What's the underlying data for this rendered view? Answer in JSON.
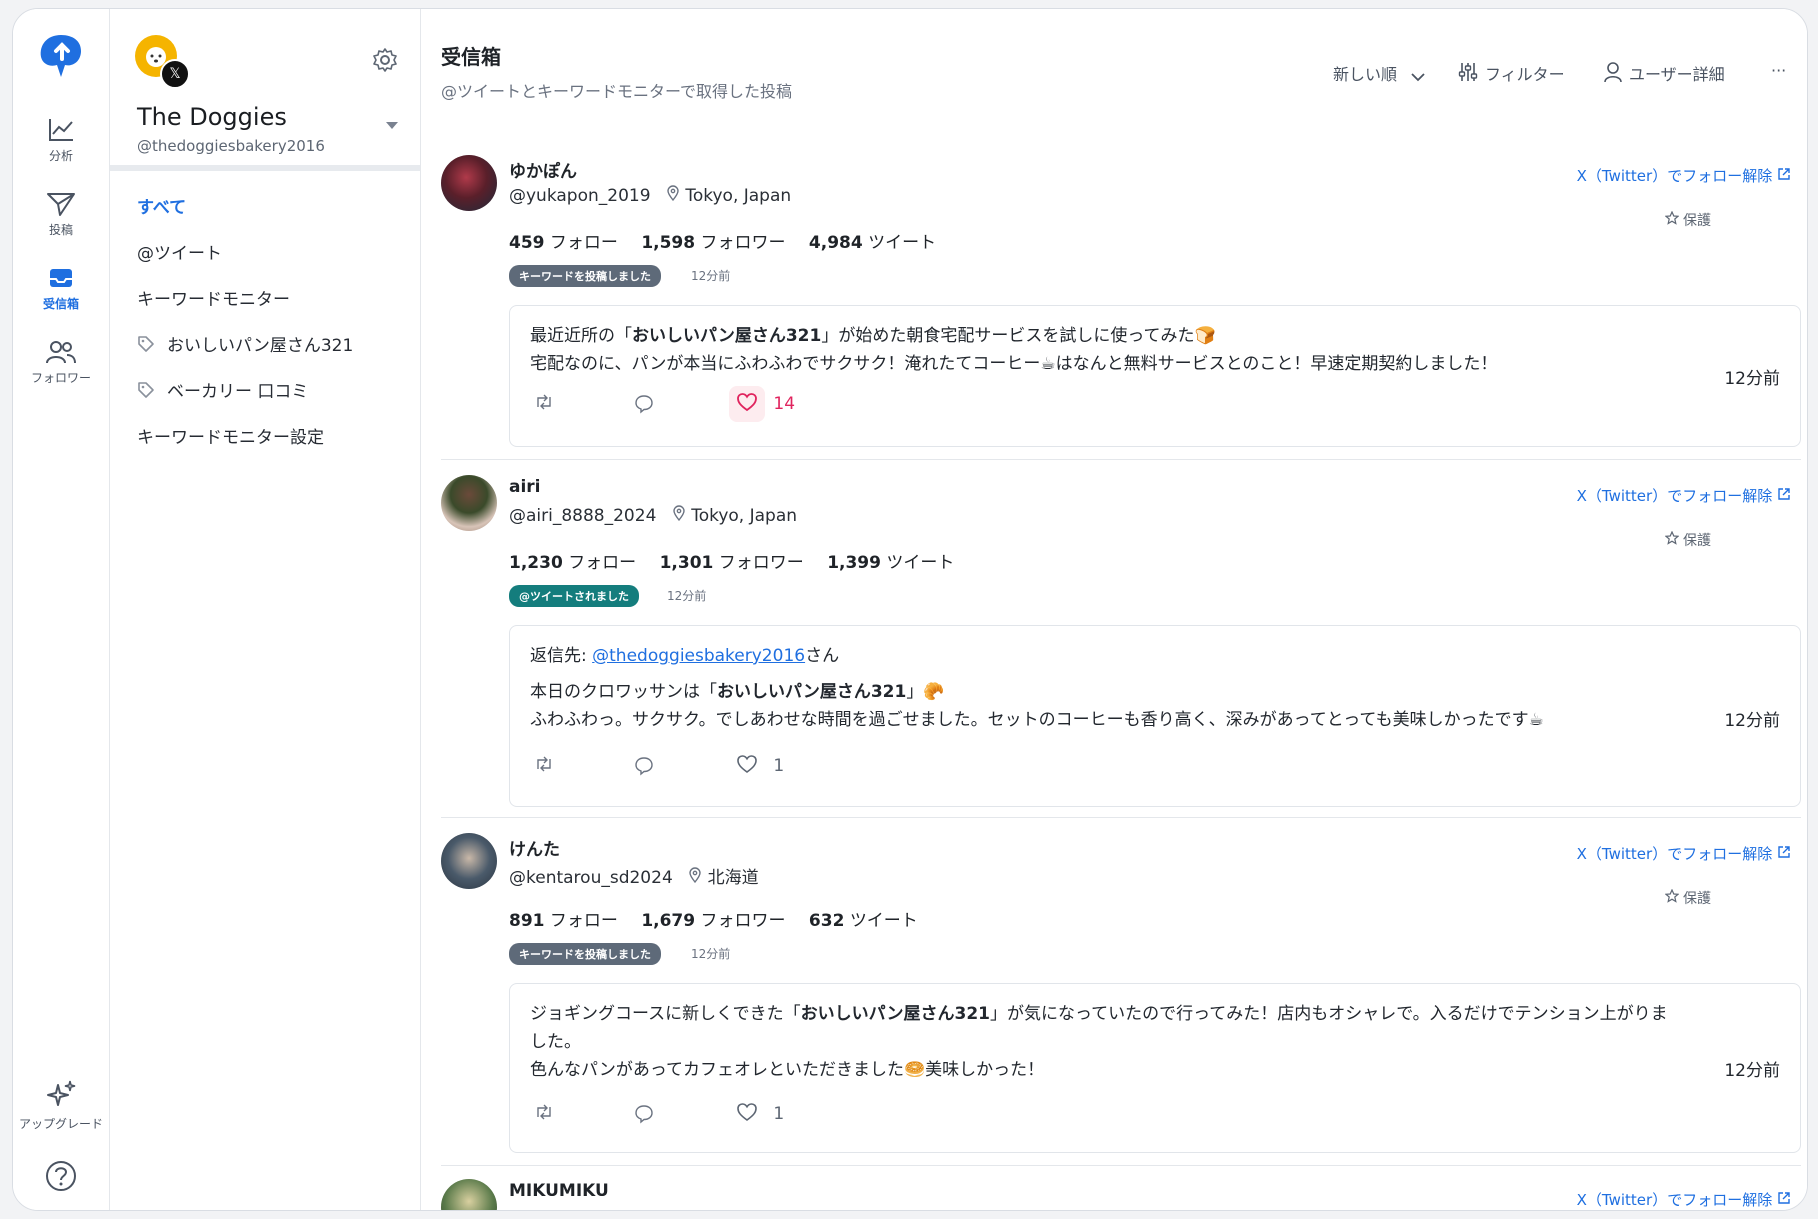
{
  "rail": {
    "items": [
      {
        "label": "分析"
      },
      {
        "label": "投稿"
      },
      {
        "label": "受信箱"
      },
      {
        "label": "フォロワー"
      }
    ],
    "upgrade": "アップグレード"
  },
  "account": {
    "name": "The Doggies",
    "handle": "@thedoggiesbakery2016"
  },
  "nav": {
    "all": "すべて",
    "tweets": "@ツイート",
    "keyword_monitor": "キーワードモニター",
    "tag1": "おいしいパン屋さん321",
    "tag2": "ベーカリー 口コミ",
    "settings": "キーワードモニター設定"
  },
  "header": {
    "title": "受信箱",
    "subtitle": "@ツイートとキーワードモニターで取得した投稿",
    "sort": "新しい順",
    "filter": "フィルター",
    "user_detail": "ユーザー詳細",
    "more": "···"
  },
  "posts": [
    {
      "name": "ゆかぽん",
      "handle": "@yukapon_2019",
      "location": "Tokyo, Japan",
      "following": "459",
      "following_label": "フォロー",
      "followers": "1,598",
      "followers_label": "フォロワー",
      "tweets": "4,984",
      "tweets_label": "ツイート",
      "badge": "キーワードを投稿しました",
      "badge_time": "12分前",
      "unfollow": "X（Twitter）でフォロー解除",
      "protect": "保護",
      "text1_pre": "最近近所の「",
      "text1_bold": "おいしいパン屋さん321",
      "text1_post": "」が始めた朝食宅配サービスを試しに使ってみた🍞",
      "text2": "宅配なのに、パンが本当にふわふわでサクサク！淹れたてコーヒー☕はなんと無料サービスとのこと！早速定期契約しました！",
      "time": "12分前",
      "likes": "14"
    },
    {
      "name": "airi",
      "handle": "@airi_8888_2024",
      "location": "Tokyo, Japan",
      "following": "1,230",
      "following_label": "フォロー",
      "followers": "1,301",
      "followers_label": "フォロワー",
      "tweets": "1,399",
      "tweets_label": "ツイート",
      "badge": "@ツイートされました",
      "badge_time": "12分前",
      "unfollow": "X（Twitter）でフォロー解除",
      "protect": "保護",
      "reply_prefix": "返信先: ",
      "reply_to": "@thedoggiesbakery2016",
      "reply_suffix": "さん",
      "text1_pre": "本日のクロワッサンは「",
      "text1_bold": "おいしいパン屋さん321",
      "text1_post": "」🥐",
      "text2": "ふわふわっ。サクサク。でしあわせな時間を過ごせました。セットのコーヒーも香り高く、深みがあってとっても美味しかったです☕",
      "time": "12分前",
      "likes": "1"
    },
    {
      "name": "けんた",
      "handle": "@kentarou_sd2024",
      "location": "北海道",
      "following": "891",
      "following_label": "フォロー",
      "followers": "1,679",
      "followers_label": "フォロワー",
      "tweets": "632",
      "tweets_label": "ツイート",
      "badge": "キーワードを投稿しました",
      "badge_time": "12分前",
      "unfollow": "X（Twitter）でフォロー解除",
      "protect": "保護",
      "text1_pre": "ジョギングコースに新しくできた「",
      "text1_bold": "おいしいパン屋さん321",
      "text1_post": "」が気になっていたので行ってみた！店内もオシャレで。入るだけでテンション上がりま",
      "text1_wrap": "した。",
      "text2": "色んなパンがあってカフェオレといただきました🥯美味しかった！",
      "time": "12分前",
      "likes": "1"
    },
    {
      "name": "MIKUMIKU",
      "unfollow": "X（Twitter）でフォロー解除"
    }
  ]
}
